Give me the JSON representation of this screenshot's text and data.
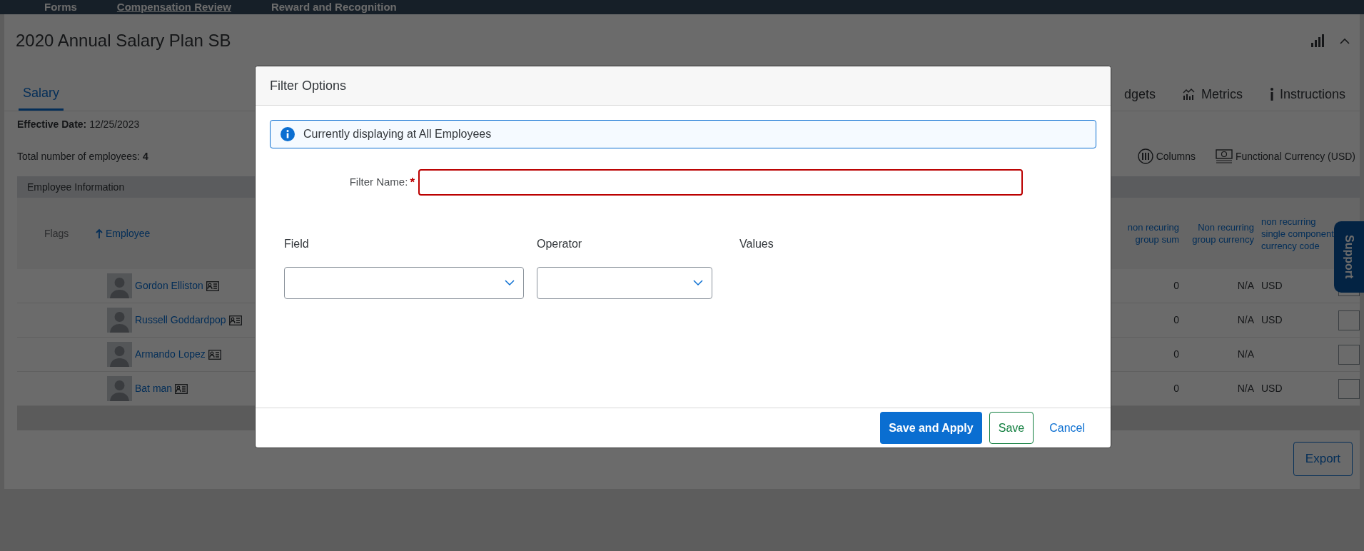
{
  "top_nav": [
    {
      "label": "Forms",
      "selected": false
    },
    {
      "label": "Compensation Review",
      "selected": true
    },
    {
      "label": "Reward and Recognition",
      "selected": false
    }
  ],
  "title": "2020 Annual Salary Plan SB",
  "tabs": [
    {
      "label": "Salary",
      "selected": true
    },
    {
      "label": "dgets",
      "selected": false
    },
    {
      "label": "Metrics",
      "selected": false
    },
    {
      "label": "Instructions",
      "selected": false
    }
  ],
  "effective_date": {
    "label": "Effective Date:",
    "value": "12/25/2023"
  },
  "employee_count": {
    "label": "Total number of employees:",
    "value": "4"
  },
  "toolbar": [
    "Columns",
    "Functional Currency (USD)"
  ],
  "table": {
    "group_header": "Employee Information",
    "columns_left": [
      {
        "label": "Flags",
        "sorted": false
      },
      {
        "label": "Employee",
        "sorted": true
      }
    ],
    "columns_right": [
      "non recuring group sum",
      "Non recurring group currency",
      "non recurring single component currency code"
    ],
    "rows": [
      {
        "employee": "Gordon Elliston",
        "cells": [
          "0",
          "N/A",
          "USD"
        ]
      },
      {
        "employee": "Russell Goddardpop",
        "cells": [
          "0",
          "N/A",
          "USD"
        ]
      },
      {
        "employee": "Armando Lopez",
        "cells": [
          "0",
          "N/A",
          null
        ]
      },
      {
        "employee": "Bat man",
        "cells": [
          "0",
          "N/A",
          "USD"
        ]
      }
    ]
  },
  "export_button": "Export",
  "support_tab": "Support",
  "dialog": {
    "title": "Filter Options",
    "info": "Currently displaying at All Employees",
    "filter_name": {
      "label": "Filter Name:",
      "required_mark": "*",
      "invalid": true
    },
    "condition_labels": [
      "Field",
      "Operator",
      "Values"
    ],
    "buttons": [
      {
        "label": "Save and Apply",
        "kind": "primary"
      },
      {
        "label": "Save",
        "kind": "secondary"
      },
      {
        "label": "Cancel",
        "kind": "link"
      }
    ]
  }
}
